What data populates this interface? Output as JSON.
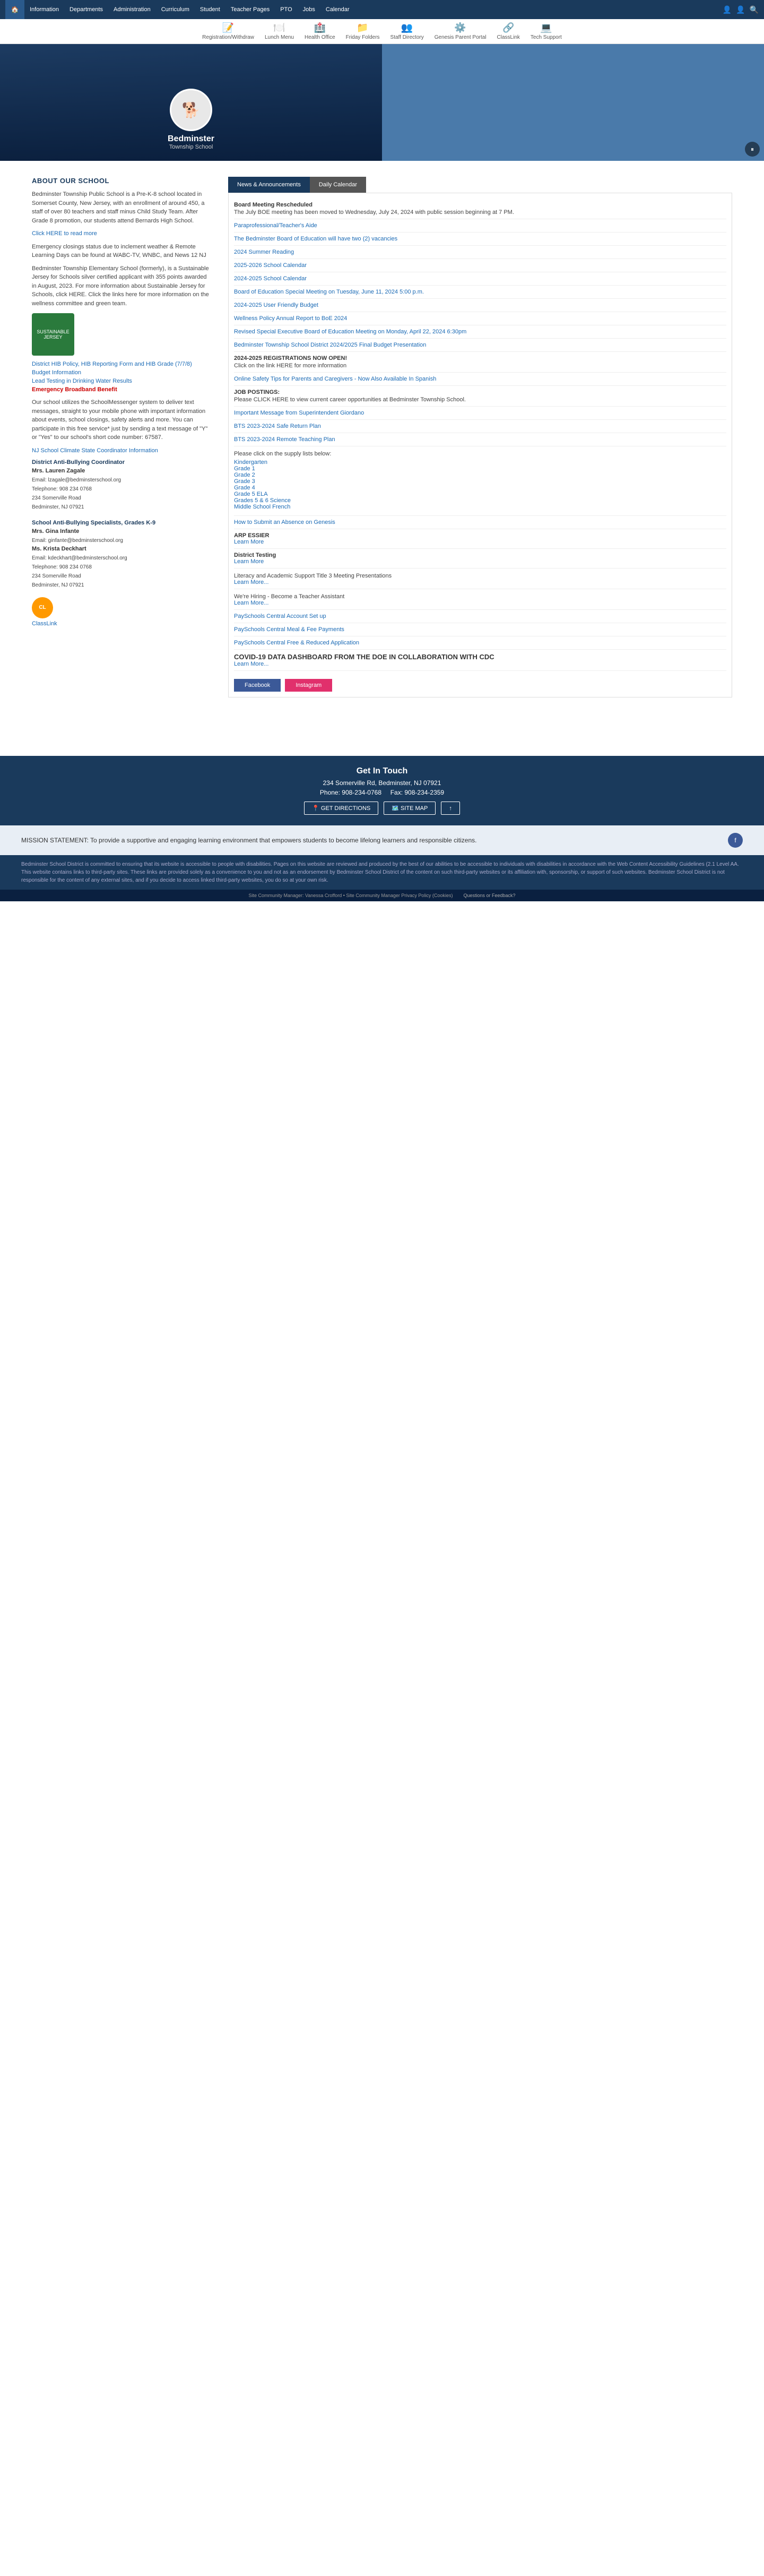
{
  "topnav": {
    "home_icon": "🏠",
    "links": [
      {
        "label": "Information",
        "href": "#"
      },
      {
        "label": "Departments",
        "href": "#"
      },
      {
        "label": "Administration",
        "href": "#"
      },
      {
        "label": "Curriculum",
        "href": "#"
      },
      {
        "label": "Student",
        "href": "#"
      },
      {
        "label": "Teacher Pages",
        "href": "#"
      },
      {
        "label": "PTO",
        "href": "#"
      },
      {
        "label": "Jobs",
        "href": "#"
      },
      {
        "label": "Calendar",
        "href": "#"
      }
    ],
    "right_icons": [
      "👤",
      "👤",
      "🔍"
    ]
  },
  "quicklinks": [
    {
      "icon": "📝",
      "label": "Registration/Withdraw"
    },
    {
      "icon": "🍽️",
      "label": "Lunch Menu"
    },
    {
      "icon": "🏥",
      "label": "Health Office"
    },
    {
      "icon": "📁",
      "label": "Friday Folders"
    },
    {
      "icon": "👥",
      "label": "Staff Directory"
    },
    {
      "icon": "⚙️",
      "label": "Genesis Parent Portal"
    },
    {
      "icon": "🔗",
      "label": "ClassLink"
    },
    {
      "icon": "💻",
      "label": "Tech Support"
    }
  ],
  "hero": {
    "school_name": "Bedminster",
    "school_sub": "Township School",
    "bulldog_emoji": "🐕"
  },
  "about": {
    "title": "ABOUT OUR SCHOOL",
    "paragraph1": "Bedminster Township Public School is a Pre-K-8 school located in Somerset County, New Jersey, with an enrollment of around 450, a staff of over 80 teachers and staff minus Child Study Team. After Grade 8 promotion, our students attend Bernards High School.",
    "click_here": "Click HERE to read more",
    "paragraph2": "Emergency closings status due to inclement weather & Remote Learning Days can be found at WABC-TV, WNBC, and News 12 NJ",
    "paragraph3": "Bedminster Township Elementary School (formerly), is a Sustainable Jersey for Schools silver certified applicant with 355 points awarded in August, 2023. For more information about Sustainable Jersey for Schools, click HERE. Click the links here for more information on the wellness committee and green team.",
    "jersey_label": "SUSTAINABLE JERSEY",
    "links": [
      {
        "label": "District HIB Policy, HIB Reporting Form and HIB Grade (7/7/8)",
        "href": "#"
      },
      {
        "label": "Budget Information",
        "href": "#"
      },
      {
        "label": "Lead Testing in Drinking Water Results",
        "href": "#"
      },
      {
        "label": "Emergency Broadband Benefit",
        "href": "#",
        "emergency": true
      }
    ],
    "schoolmessenger_text": "Our school utilizes the SchoolMessenger system to deliver text messages, straight to your mobile phone with important information about events, school closings, safety alerts and more. You can participate in this free service* just by sending a text message of \"Y\" or \"Yes\" to our school's short code number: 67587.",
    "nj_climate": "NJ School Climate State Coordinator Information",
    "anti_bully_title": "District Anti-Bullying Coordinator",
    "anti_bully_name": "Mrs. Lauren Zagale",
    "anti_bully_email": "Email: lzagale@bedminsterschool.org",
    "anti_bully_phone": "Telephone: 908 234 0768",
    "anti_bully_address1": "234 Somerville Road",
    "anti_bully_address2": "Bedminster, NJ 07921",
    "specialist_title": "School Anti-Bullying Specialists, Grades K-9",
    "specialist1_name": "Mrs. Gina Infante",
    "specialist1_email": "Email: ginfante@bedminsterschool.org",
    "specialist2_name": "Ms. Krista Deckhart",
    "specialist2_email": "Email: kdeckhart@bedminsterschool.org",
    "specialist2_phone": "Telephone: 908 234 0768",
    "specialist2_address1": "234 Somerville Road",
    "specialist2_address2": "Bedminster, NJ 07921",
    "classlink_label": "ClassLink"
  },
  "news": {
    "tab_news": "News & Announcements",
    "tab_calendar": "Daily Calendar",
    "items": [
      {
        "type": "bold",
        "text": "Board Meeting Rescheduled"
      },
      {
        "type": "text",
        "text": "The July BOE meeting has been moved to Wednesday, July 24, 2024 with public session beginning at 7 PM."
      },
      {
        "type": "link",
        "text": "Paraprofessional/Teacher's Aide"
      },
      {
        "type": "link",
        "text": "The Bedminster Board of Education will have two (2) vacancies"
      },
      {
        "type": "link",
        "text": "2024 Summer Reading"
      },
      {
        "type": "link",
        "text": "2025-2026 School Calendar"
      },
      {
        "type": "link",
        "text": "2024-2025 School Calendar"
      },
      {
        "type": "link",
        "text": "Board of Education Special Meeting on Tuesday, June 11, 2024 5:00 p.m."
      },
      {
        "type": "link",
        "text": "2024-2025 User Friendly Budget"
      },
      {
        "type": "link",
        "text": "Wellness Policy Annual Report to BoE 2024"
      },
      {
        "type": "link",
        "text": "Revised Special Executive Board of Education Meeting on Monday, April 22, 2024 6:30pm"
      },
      {
        "type": "link",
        "text": "Bedminster Township School District 2024/2025 Final Budget Presentation"
      },
      {
        "type": "bold",
        "text": "2024-2025 REGISTRATIONS NOW OPEN!"
      },
      {
        "type": "text",
        "text": "Click on the link HERE for more information"
      },
      {
        "type": "link",
        "text": "Online Safety Tips for Parents and Caregivers - Now Also Available In Spanish"
      },
      {
        "type": "bold",
        "text": "JOB POSTINGS:"
      },
      {
        "type": "text",
        "text": "Please CLICK HERE to view current career opportunities at Bedminster Township School."
      },
      {
        "type": "link",
        "text": "Important Message from Superintendent Giordano"
      },
      {
        "type": "link",
        "text": "BTS 2023-2024 Safe Return Plan"
      },
      {
        "type": "link",
        "text": "BTS 2023-2024 Remote Teaching Plan"
      },
      {
        "type": "text",
        "text": "Please click on the supply lists below:"
      },
      {
        "type": "supply",
        "items": [
          "Kindergarten",
          "Grade 1",
          "Grade 2",
          "Grade 3",
          "Grade 4",
          "Grade 5 ELA",
          "Grades 5 & 6 Science",
          "Middle School French"
        ]
      },
      {
        "type": "link",
        "text": "How to Submit an Absence on Genesis"
      },
      {
        "type": "bold",
        "text": "ARP ESSIER"
      },
      {
        "type": "link",
        "text": "Learn More"
      },
      {
        "type": "bold",
        "text": "District Testing"
      },
      {
        "type": "link",
        "text": "Learn More"
      },
      {
        "type": "text",
        "text": "Literacy and Academic Support Title 3 Meeting Presentations"
      },
      {
        "type": "link",
        "text": "Learn More..."
      },
      {
        "type": "text",
        "text": "We're Hiring - Become a Teacher Assistant"
      },
      {
        "type": "link",
        "text": "Learn More..."
      },
      {
        "type": "link",
        "text": "PaySchools Central Account Set up"
      },
      {
        "type": "link",
        "text": "PaySchools Central Meal & Fee Payments"
      },
      {
        "type": "link",
        "text": "PaySchools Central Free & Reduced Application"
      },
      {
        "type": "header",
        "text": "COVID-19 DATA DASHBOARD FROM THE DOE IN COLLABORATION WITH CDC"
      },
      {
        "type": "link",
        "text": "Learn More..."
      }
    ],
    "facebook_label": "Facebook",
    "instagram_label": "Instagram"
  },
  "footer": {
    "get_in_touch": "Get In Touch",
    "address": "234 Somerville Rd, Bedminster, NJ 07921",
    "phone": "Phone: 908-234-0768",
    "fax": "Fax: 908-234-2359",
    "btn_directions": "GET DIRECTIONS",
    "btn_sitemap": "SITE MAP",
    "up_arrow": "↑",
    "mission": "MISSION STATEMENT: To provide a supportive and engaging learning environment that empowers students to become lifelong learners and responsible citizens.",
    "accessibility_text": "Bedminster School District is committed to ensuring that its website is accessible to people with disabilities. Pages on this website are reviewed and produced by the best of our abilities to be accessible to individuals with disabilities in accordance with the Web Content Accessibility Guidelines (2.1 Level AA. This website contains links to third-party sites. These links are provided solely as a convenience to you and not as an endorsement by Bedminster School District of the content on such third-party websites or its affiliation with, sponsorship, or support of such websites. Bedminster School District is not responsible for the content of any external sites, and if you decide to access linked third-party websites, you do so at your own risk.",
    "footer_bottom_left": "Site Community Manager: Vanessa Crofford • Site Community Manager Privacy Policy (Cookies)",
    "footer_bottom_right": "Questions or Feedback?"
  }
}
